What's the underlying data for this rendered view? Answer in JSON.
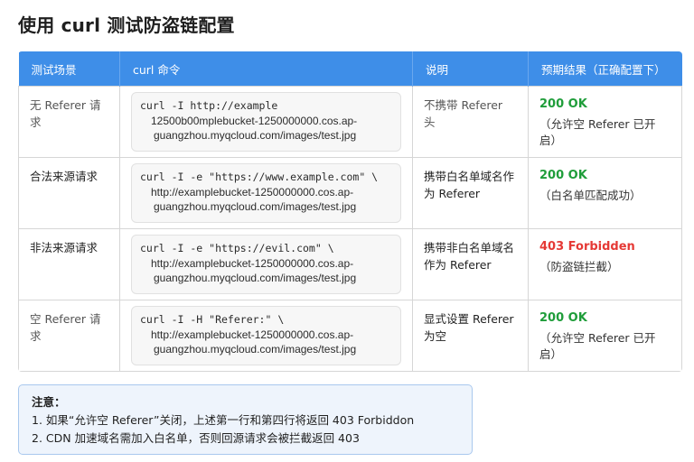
{
  "page": {
    "title": "使用 curl 测试防盗链配置"
  },
  "table": {
    "headers": {
      "scene": "测试场景",
      "command": "curl 命令",
      "desc": "说明",
      "expected": "预期结果（正确配置下）"
    },
    "rows": [
      {
        "scene": "无 Referer 请求",
        "cmd_lines": [
          "curl -I http://example",
          "12500b00mplebucket-1250000000.cos.ap-",
          "guangzhou.myqcloud.com/images/test.jpg"
        ],
        "desc": "不携带 Referer 头",
        "status": "200 OK",
        "note": "（允许空 Referer 已开启）"
      },
      {
        "scene": "合法来源请求",
        "cmd_lines": [
          "curl -I -e \"https://www.example.com\" \\",
          "http://examplebucket-1250000000.cos.ap-",
          "guangzhou.myqcloud.com/images/test.jpg"
        ],
        "desc": "携带白名单域名作为 Referer",
        "status": "200 OK",
        "note": "（白名单匹配成功）"
      },
      {
        "scene": "非法来源请求",
        "cmd_lines": [
          "curl -I -e \"https://evil.com\" \\",
          "http://examplebucket-1250000000.cos.ap-",
          "guangzhou.myqcloud.com/images/test.jpg"
        ],
        "desc": "携带非白名单域名作为 Referer",
        "status": "403 Forbidden",
        "note": "（防盗链拦截）"
      },
      {
        "scene": "空 Referer 请求",
        "cmd_lines": [
          "curl -I -H \"Referer:\" \\",
          "http://examplebucket-1250000000.cos.ap-",
          "guangzhou.myqcloud.com/images/test.jpg"
        ],
        "desc": "显式设置 Referer 为空",
        "status": "200 OK",
        "note": "（允许空 Referer 已开启）"
      }
    ]
  },
  "note": {
    "title": "注意：",
    "items": [
      "1. 如果“允许空 Referer”关闭，上述第一行和第四行将返回 403 Forbiddon",
      "2. CDN 加速域名需加入白名单，否则回源请求会被拦截返回 403"
    ]
  },
  "colors": {
    "header_bg": "#3e8ee8",
    "ok": "#1f9d3a",
    "forbidden": "#e53935",
    "note_bg": "#eef4fc",
    "note_border": "#a9c8ee"
  }
}
